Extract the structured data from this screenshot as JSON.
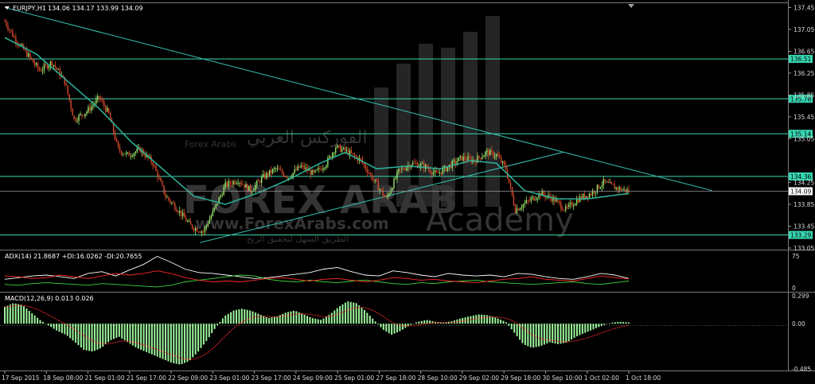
{
  "window": {
    "symbol_header": "EURJPY,H1",
    "ohlc": "134.06 134.17 133.99 134.09"
  },
  "watermark": {
    "brand": "FOREX ARAB",
    "site": "www.ForexArabs.com",
    "academy": "Academy",
    "arabic_title": "الفوركس العربي",
    "arabic_sub": "الطريق السهل لتحقيق الربح",
    "logo_text": "Forex Arabs"
  },
  "colors": {
    "background": "#000000",
    "grid_frame": "#7a7a7a",
    "bull_candle": "#9be86c",
    "bear_candle": "#d84a2a",
    "ma_line": "#2bb39b",
    "horizontal_levels": "#37d8b2",
    "trendline": "#37c4b0",
    "adx_main": "#ffffff",
    "di_plus": "#3bd43b",
    "di_minus": "#ff2a2a",
    "macd_hist": "#9df59d",
    "macd_signal": "#ff2a2a",
    "price_tag": "#37d8b2",
    "current_tag": "#ffffff"
  },
  "chart_data": [
    {
      "type": "candlestick",
      "title": "EURJPY,H1",
      "ylim": [
        133.05,
        137.5
      ],
      "y_ticks": [
        "137.45",
        "137.05",
        "136.65",
        "136.25",
        "135.85",
        "135.45",
        "135.05",
        "134.25",
        "133.85",
        "133.45",
        "133.05"
      ],
      "x_tick_labels": [
        "17 Sep 2015",
        "18 Sep 08:00",
        "21 Sep 01:00",
        "21 Sep 17:00",
        "22 Sep 09:00",
        "23 Sep 01:00",
        "23 Sep 17:00",
        "24 Sep 09:00",
        "25 Sep 01:00",
        "27 Sep 18:00",
        "28 Sep 10:00",
        "29 Sep 02:00",
        "29 Sep 18:00",
        "30 Sep 10:00",
        "1 Oct 02:00",
        "1 Oct 18:00"
      ],
      "horizontal_levels": [
        136.51,
        135.78,
        135.14,
        134.36,
        133.29
      ],
      "current_price": 134.09,
      "grid": false,
      "close_path": [
        [
          0,
          137.2
        ],
        [
          6,
          136.9
        ],
        [
          14,
          136.6
        ],
        [
          22,
          136.3
        ],
        [
          30,
          136.45
        ],
        [
          38,
          136.1
        ],
        [
          44,
          135.4
        ],
        [
          52,
          135.55
        ],
        [
          60,
          135.8
        ],
        [
          66,
          135.5
        ],
        [
          72,
          134.85
        ],
        [
          78,
          134.75
        ],
        [
          86,
          134.85
        ],
        [
          94,
          134.6
        ],
        [
          102,
          134.0
        ],
        [
          110,
          133.75
        ],
        [
          118,
          133.45
        ],
        [
          126,
          133.35
        ],
        [
          132,
          133.7
        ],
        [
          140,
          134.2
        ],
        [
          148,
          134.3
        ],
        [
          156,
          134.1
        ],
        [
          164,
          134.35
        ],
        [
          172,
          134.5
        ],
        [
          180,
          134.35
        ],
        [
          188,
          134.55
        ],
        [
          196,
          134.4
        ],
        [
          204,
          134.6
        ],
        [
          210,
          134.9
        ],
        [
          218,
          134.8
        ],
        [
          226,
          134.65
        ],
        [
          234,
          134.3
        ],
        [
          242,
          133.95
        ],
        [
          250,
          134.45
        ],
        [
          258,
          134.6
        ],
        [
          266,
          134.55
        ],
        [
          274,
          134.4
        ],
        [
          282,
          134.55
        ],
        [
          290,
          134.7
        ],
        [
          298,
          134.65
        ],
        [
          306,
          134.8
        ],
        [
          312,
          134.75
        ],
        [
          318,
          134.5
        ],
        [
          324,
          133.75
        ],
        [
          332,
          133.9
        ],
        [
          340,
          134.05
        ],
        [
          348,
          133.95
        ],
        [
          356,
          133.75
        ],
        [
          364,
          133.95
        ],
        [
          372,
          134.05
        ],
        [
          380,
          134.25
        ],
        [
          388,
          134.15
        ],
        [
          396,
          134.09
        ]
      ],
      "moving_average_path": [
        [
          0,
          136.9
        ],
        [
          20,
          136.6
        ],
        [
          40,
          136.1
        ],
        [
          60,
          135.6
        ],
        [
          80,
          135.0
        ],
        [
          100,
          134.5
        ],
        [
          120,
          134.0
        ],
        [
          140,
          133.85
        ],
        [
          160,
          134.05
        ],
        [
          180,
          134.3
        ],
        [
          200,
          134.6
        ],
        [
          216,
          134.8
        ],
        [
          236,
          134.5
        ],
        [
          256,
          134.55
        ],
        [
          276,
          134.5
        ],
        [
          296,
          134.65
        ],
        [
          312,
          134.6
        ],
        [
          330,
          134.1
        ],
        [
          350,
          133.95
        ],
        [
          370,
          133.95
        ],
        [
          396,
          134.05
        ]
      ],
      "trendlines": [
        {
          "from": [
            0,
            137.45
          ],
          "to": [
            449,
            134.1
          ]
        },
        {
          "from": [
            124,
            133.15
          ],
          "to": [
            354,
            134.8
          ]
        }
      ]
    },
    {
      "type": "line",
      "title": "ADX(14) 21.8687 +DI:16.0262 -DI:20.7655",
      "ylim": [
        0,
        75
      ],
      "y_ticks": [
        "75",
        "0"
      ],
      "series": [
        {
          "name": "ADX(14)",
          "values": [
            20,
            24,
            28,
            30,
            26,
            22,
            34,
            38,
            28,
            42,
            55,
            74,
            60,
            44,
            36,
            34,
            30,
            26,
            22,
            24,
            28,
            32,
            36,
            44,
            48,
            38,
            30,
            28,
            40,
            36,
            30,
            26,
            34,
            30,
            28,
            30,
            26,
            34,
            32,
            26,
            22,
            20,
            26,
            34,
            30,
            22
          ]
        },
        {
          "name": "+DI",
          "values": [
            8,
            6,
            10,
            12,
            10,
            8,
            6,
            10,
            8,
            6,
            4,
            2,
            6,
            14,
            18,
            22,
            26,
            30,
            28,
            20,
            16,
            14,
            18,
            14,
            12,
            16,
            18,
            14,
            10,
            8,
            12,
            10,
            14,
            16,
            18,
            14,
            12,
            10,
            8,
            10,
            12,
            14,
            10,
            8,
            12,
            16
          ]
        },
        {
          "name": "-DI",
          "values": [
            28,
            26,
            22,
            24,
            30,
            26,
            22,
            28,
            34,
            30,
            34,
            40,
            34,
            24,
            18,
            14,
            16,
            14,
            18,
            22,
            24,
            20,
            16,
            20,
            22,
            18,
            14,
            18,
            24,
            22,
            18,
            20,
            16,
            14,
            12,
            16,
            20,
            22,
            26,
            20,
            18,
            16,
            22,
            28,
            24,
            21
          ]
        }
      ]
    },
    {
      "type": "bar",
      "title": "MACD(12,26,9) 0.013 0.026",
      "ylim": [
        -0.485,
        0.299
      ],
      "y_ticks": [
        "0.299",
        "0.00",
        "-0.485"
      ],
      "series": [
        {
          "name": "MACD",
          "values": [
            0.18,
            0.22,
            0.2,
            0.12,
            0.04,
            -0.02,
            -0.08,
            -0.12,
            -0.2,
            -0.28,
            -0.3,
            -0.26,
            -0.18,
            -0.14,
            -0.2,
            -0.26,
            -0.3,
            -0.34,
            -0.38,
            -0.42,
            -0.44,
            -0.4,
            -0.3,
            -0.18,
            -0.04,
            0.08,
            0.14,
            0.16,
            0.14,
            0.1,
            0.06,
            0.08,
            0.12,
            0.14,
            0.1,
            0.06,
            0.04,
            0.1,
            0.18,
            0.24,
            0.22,
            0.14,
            0.04,
            -0.06,
            -0.12,
            -0.08,
            -0.02,
            0.02,
            0.04,
            0.02,
            0.01,
            0.03,
            0.06,
            0.08,
            0.1,
            0.09,
            0.06,
            0.02,
            -0.1,
            -0.22,
            -0.26,
            -0.24,
            -0.2,
            -0.22,
            -0.2,
            -0.14,
            -0.1,
            -0.06,
            -0.02,
            0.01,
            0.02,
            0.013
          ]
        }
      ]
    }
  ]
}
